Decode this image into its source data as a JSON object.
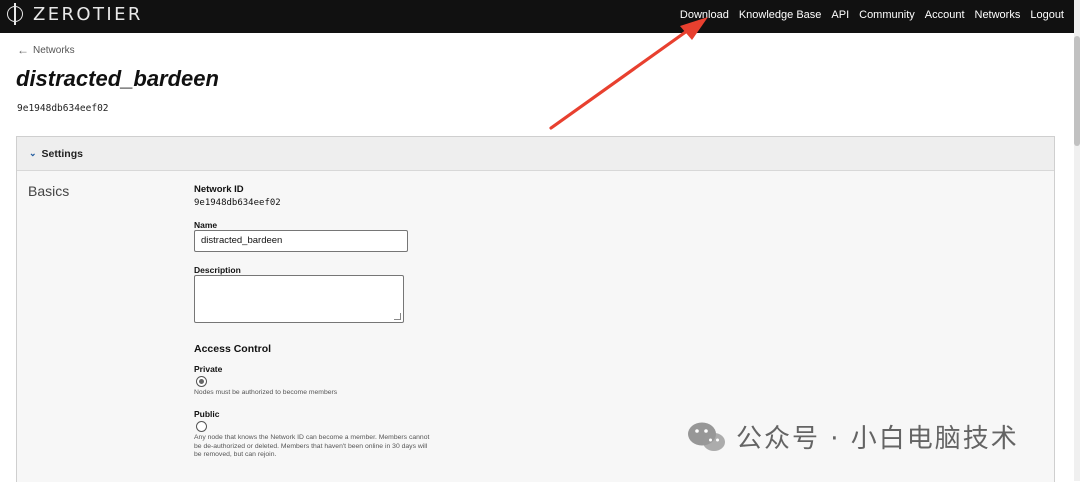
{
  "brand": {
    "name": "ZEROTIER"
  },
  "nav": {
    "items": [
      "Download",
      "Knowledge Base",
      "API",
      "Community",
      "Account",
      "Networks",
      "Logout"
    ]
  },
  "breadcrumb": {
    "back_label": "Networks"
  },
  "network": {
    "title": "distracted_bardeen",
    "id": "9e1948db634eef02"
  },
  "settings": {
    "header": "Settings",
    "section": "Basics",
    "network_id_label": "Network ID",
    "network_id_value": "9e1948db634eef02",
    "name_label": "Name",
    "name_value": "distracted_bardeen",
    "description_label": "Description",
    "description_value": "",
    "access_control_label": "Access Control",
    "private_label": "Private",
    "private_desc": "Nodes must be authorized to become members",
    "public_label": "Public",
    "public_desc": "Any node that knows the Network ID can become a member. Members cannot be de-authorized or deleted. Members that haven't been online in 30 days will be removed, but can rejoin.",
    "selected_access": "Private"
  },
  "watermark": {
    "text": "公众号 · 小白电脑技术"
  },
  "colors": {
    "topbar": "#111111",
    "annotation_arrow": "#e8402f",
    "chevron": "#1f5a9e"
  }
}
